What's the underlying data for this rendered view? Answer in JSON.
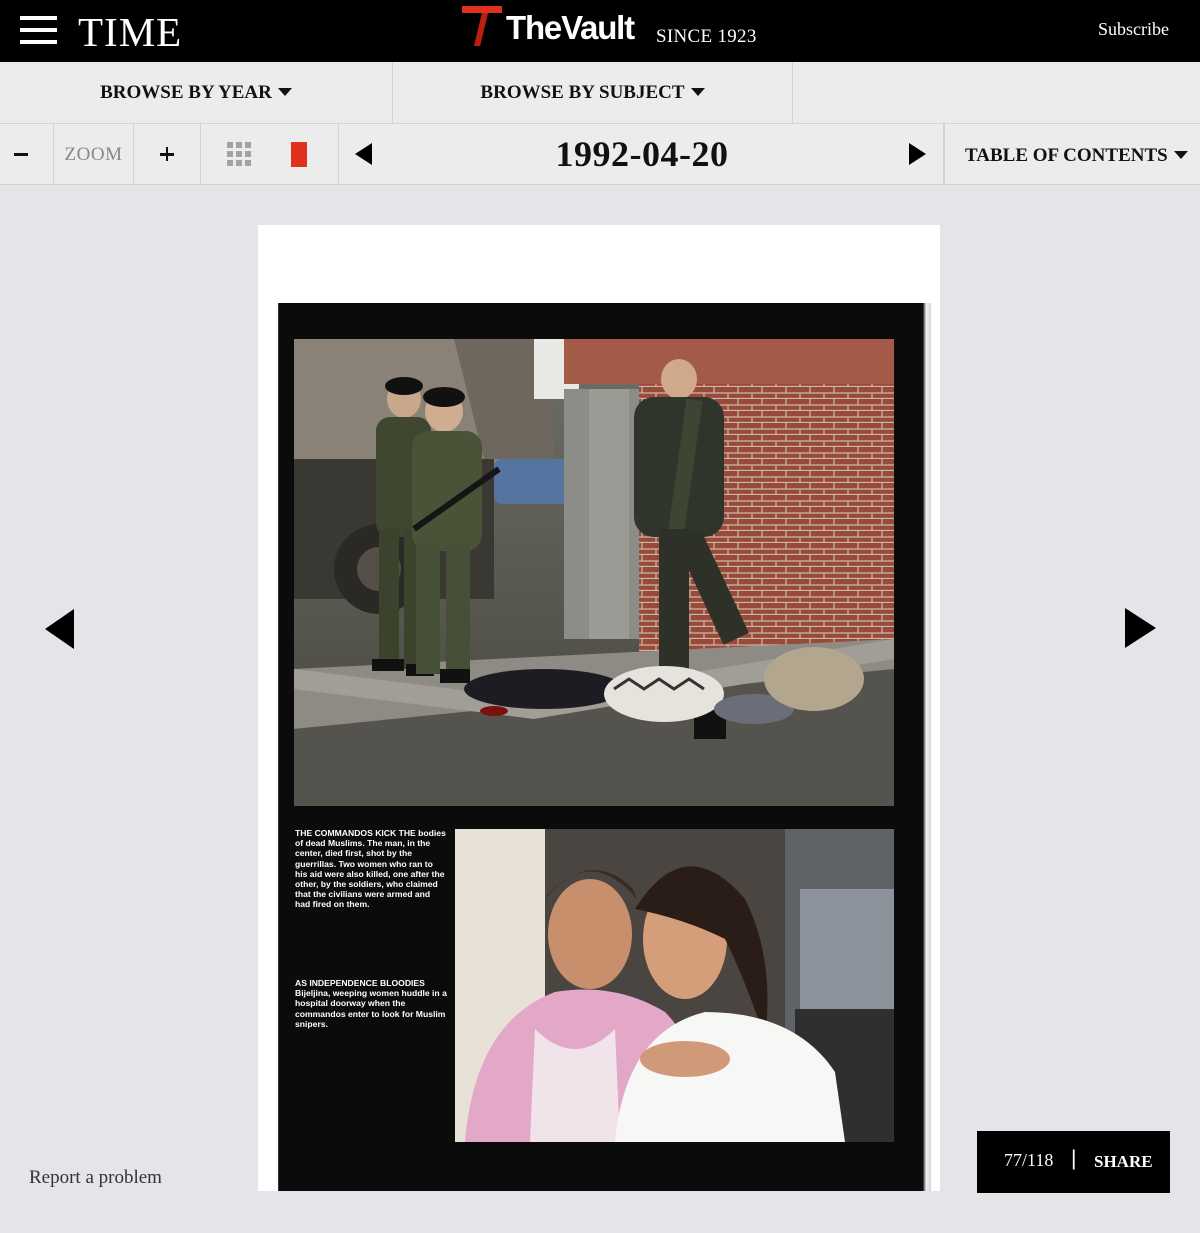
{
  "header": {
    "brand": "TIME",
    "vault_name": "TheVault",
    "vault_since": "SINCE 1923",
    "subscribe_label": "Subscribe"
  },
  "browse": {
    "by_year_label": "BROWSE BY YEAR",
    "by_subject_label": "BROWSE BY SUBJECT"
  },
  "toolbar": {
    "zoom_label": "ZOOM",
    "issue_date": "1992-04-20",
    "toc_label": "TABLE OF CONTENTS"
  },
  "page": {
    "caption_1": "THE COMMANDOS KICK THE bodies of dead Muslims. The man, in the center, died first, shot by the guerrillas. Two women who ran to his aid were also killed, one after the other, by the soldiers, who claimed that the civilians were armed and had fired on them.",
    "caption_2": "AS INDEPENDENCE BLOODIES Bijeljina, weeping women huddle in a hospital doorway when the commandos enter to look for Muslim snipers."
  },
  "footer": {
    "report_label": "Report a problem",
    "page_count": "77/118",
    "separator": "|",
    "share_label": "SHARE"
  },
  "colors": {
    "header_bg": "#000000",
    "toolbar_bg": "#ececec",
    "viewer_bg": "#e6e4e8",
    "accent_red": "#e0301e"
  }
}
